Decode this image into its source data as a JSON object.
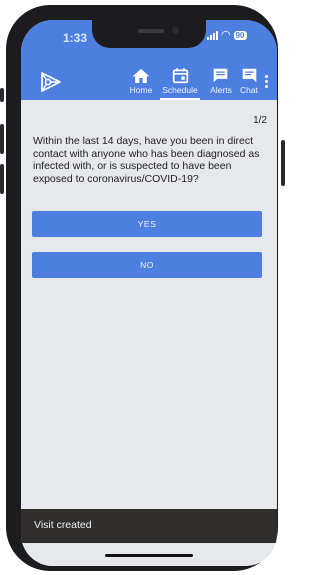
{
  "status_bar": {
    "time": "1:33",
    "battery": "90"
  },
  "nav": {
    "items": [
      {
        "label": "Home",
        "icon": "home-icon"
      },
      {
        "label": "Schedule",
        "icon": "calendar-icon"
      },
      {
        "label": "Alerts",
        "icon": "alert-message-icon"
      },
      {
        "label": "Chat",
        "icon": "chat-icon"
      }
    ],
    "active": "Schedule"
  },
  "survey": {
    "page_indicator": "1/2",
    "question": "Within the last 14 days, have you been in direct contact with anyone who has been diagnosed as infected with, or is suspected to have been exposed to coronavirus/COVID-19?",
    "answers": [
      {
        "label": "YES"
      },
      {
        "label": "NO"
      }
    ]
  },
  "snackbar": {
    "message": "Visit created"
  },
  "colors": {
    "primary": "#4d7fe0",
    "background": "#e6e8ec",
    "snackbar": "#2f2e2c"
  }
}
